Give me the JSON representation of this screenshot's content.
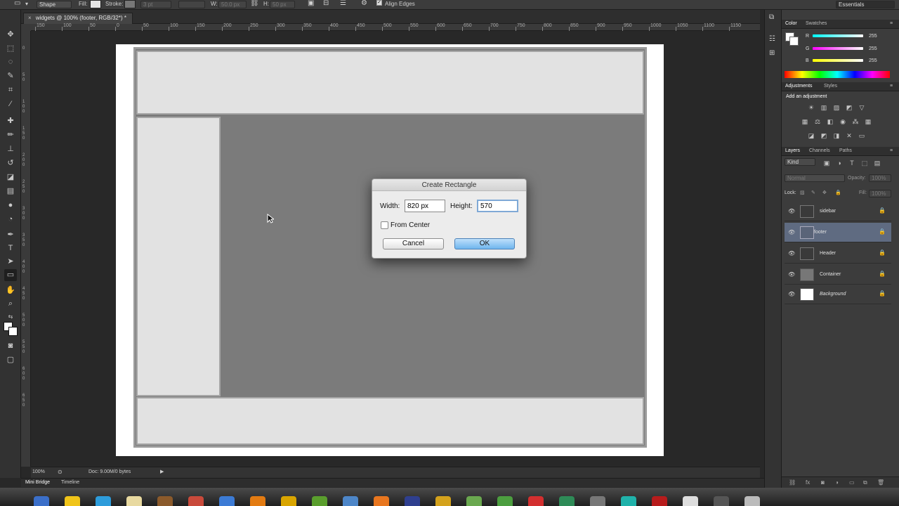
{
  "options_bar": {
    "mode": "Shape",
    "fill_label": "Fill:",
    "stroke_label": "Stroke:",
    "stroke_size": "3 pt",
    "w_label": "W:",
    "w_value": "50.0 px",
    "h_label": "H:",
    "h_value": "50 px",
    "align_edges": "Align Edges",
    "workspace": "Essentials"
  },
  "document_tab": "widgets @ 100% (footer, RGB/32*) *",
  "ruler": {
    "h_labels": [
      "150",
      "100",
      "50",
      "0",
      "50",
      "100",
      "150",
      "200",
      "250",
      "300",
      "350",
      "400",
      "450",
      "500",
      "550",
      "600",
      "650",
      "700",
      "750",
      "800",
      "850",
      "900",
      "950",
      "1000",
      "1050",
      "1100",
      "1150"
    ],
    "v_labels": [
      "0",
      "5 0",
      "1 0 0",
      "1 5 0",
      "2 0 0",
      "2 5 0",
      "3 0 0",
      "3 5 0",
      "4 0 0",
      "4 5 0",
      "5 0 0",
      "5 5 0",
      "6 0 0",
      "6 5 0"
    ]
  },
  "status_bar": {
    "zoom": "100%",
    "doc_info": "Doc: 9.00M/0 bytes"
  },
  "bottom_tabs": [
    "Mini Bridge",
    "Timeline"
  ],
  "color_panel": {
    "tabs": [
      "Color",
      "Swatches"
    ],
    "channels": [
      {
        "label": "R",
        "value": "255"
      },
      {
        "label": "G",
        "value": "255"
      },
      {
        "label": "B",
        "value": "255"
      }
    ]
  },
  "adjustments_panel": {
    "tabs": [
      "Adjustments",
      "Styles"
    ],
    "heading": "Add an adjustment"
  },
  "layers_panel": {
    "tabs": [
      "Layers",
      "Channels",
      "Paths"
    ],
    "filter_kind": "Kind",
    "blend_mode": "Normal",
    "opacity_label": "Opacity:",
    "opacity_value": "100%",
    "lock_label": "Lock:",
    "fill_label": "Fill:",
    "fill_value": "100%",
    "layers": [
      {
        "name": "sidebar",
        "selected": false
      },
      {
        "name": "footer",
        "selected": true
      },
      {
        "name": "Header",
        "selected": false
      },
      {
        "name": "Container",
        "selected": false
      },
      {
        "name": "Background",
        "selected": false
      }
    ]
  },
  "dialog": {
    "title": "Create Rectangle",
    "width_label": "Width:",
    "width_value": "820 px",
    "height_label": "Height:",
    "height_value": "570",
    "from_center_label": "From Center",
    "from_center_checked": false,
    "cancel_label": "Cancel",
    "ok_label": "OK"
  },
  "colors": {
    "ui_dark": "#282828",
    "panel": "#3c3c3c",
    "selected_layer": "#5f6b81",
    "canvas_white": "#ffffff",
    "shape_light": "#e2e2e2",
    "shape_mid": "#7a7a7a",
    "ok_button": "#6fb5ee"
  }
}
